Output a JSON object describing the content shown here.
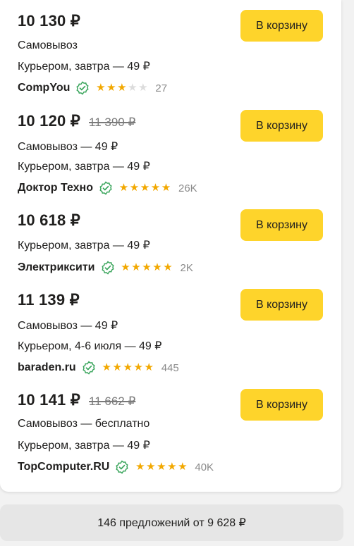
{
  "offers": [
    {
      "price": "10 130 ₽",
      "old_price": "",
      "delivery_lines": [
        "Самовывоз",
        "Курьером, завтра — 49 ₽"
      ],
      "seller": "CompYou",
      "rating": 3,
      "reviews": "27",
      "button_label": "В корзину"
    },
    {
      "price": "10 120 ₽",
      "old_price": "11 390 ₽",
      "delivery_lines": [
        "Самовывоз — 49 ₽",
        "Курьером, завтра — 49 ₽"
      ],
      "seller": "Доктор Техно",
      "rating": 5,
      "reviews": "26K",
      "button_label": "В корзину"
    },
    {
      "price": "10 618 ₽",
      "old_price": "",
      "delivery_lines": [
        "Курьером, завтра — 49 ₽"
      ],
      "seller": "Электриксити",
      "rating": 5,
      "reviews": "2K",
      "button_label": "В корзину"
    },
    {
      "price": "11 139 ₽",
      "old_price": "",
      "delivery_lines": [
        "Самовывоз — 49 ₽",
        "Курьером, 4-6 июля — 49 ₽"
      ],
      "seller": "baraden.ru",
      "rating": 5,
      "reviews": "445",
      "button_label": "В корзину"
    },
    {
      "price": "10 141 ₽",
      "old_price": "11 662 ₽",
      "delivery_lines": [
        "Самовывоз — бесплатно",
        "Курьером, завтра — 49 ₽"
      ],
      "seller": "TopComputer.RU",
      "rating": 5,
      "reviews": "40K",
      "button_label": "В корзину"
    }
  ],
  "footer": {
    "label": "146 предложений от 9 628 ₽"
  },
  "colors": {
    "button": "#fed42b",
    "star": "#f2a800",
    "verified": "#3aa55c"
  },
  "icons": {
    "verified": "verified-check-icon",
    "star": "star-icon"
  }
}
